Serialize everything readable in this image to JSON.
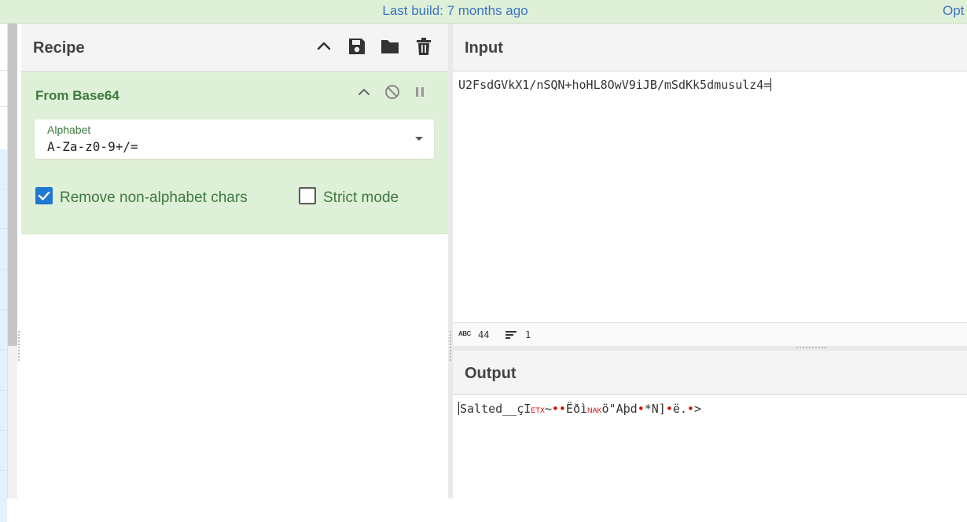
{
  "banner": {
    "build_text": "Last build: 7 months ago",
    "options_text": "Opt"
  },
  "recipe": {
    "title": "Recipe",
    "icons": [
      "chevron-up-icon",
      "save-icon",
      "folder-icon",
      "trash-icon"
    ],
    "operation": {
      "name": "From Base64",
      "icons": [
        "chevron-up-icon",
        "disable-icon",
        "pause-icon"
      ],
      "alphabet": {
        "label": "Alphabet",
        "value": "A-Za-z0-9+/="
      },
      "remove_non_alphabet": {
        "label": "Remove non-alphabet chars",
        "checked": true
      },
      "strict_mode": {
        "label": "Strict mode",
        "checked": false
      }
    }
  },
  "input": {
    "title": "Input",
    "value": "U2FsdGVkX1/nSQN+hoHL8OwV9iJB/mSdKk5dmusulz4=",
    "status": {
      "char_count": "44",
      "line_count": "1"
    }
  },
  "output": {
    "title": "Output",
    "segments": [
      {
        "t": "Salted__çI",
        "k": "text"
      },
      {
        "t": "ETX",
        "k": "ctl"
      },
      {
        "t": "~",
        "k": "text"
      },
      {
        "t": "••",
        "k": "dot"
      },
      {
        "t": "Ëðì",
        "k": "text"
      },
      {
        "t": "NAK",
        "k": "ctl"
      },
      {
        "t": "ö\"Aþd",
        "k": "text"
      },
      {
        "t": "•",
        "k": "dot"
      },
      {
        "t": "*N]",
        "k": "text"
      },
      {
        "t": "•",
        "k": "dot"
      },
      {
        "t": "ë.",
        "k": "text"
      },
      {
        "t": "•",
        "k": "dot"
      },
      {
        "t": ">",
        "k": "text"
      }
    ]
  },
  "colors": {
    "banner_bg": "#dff0d8",
    "link": "#3b73c4",
    "operation_bg": "#dff0d8",
    "operation_text": "#3d7a3d",
    "checkbox_checked": "#1f78d1",
    "control_char": "#d40000"
  }
}
